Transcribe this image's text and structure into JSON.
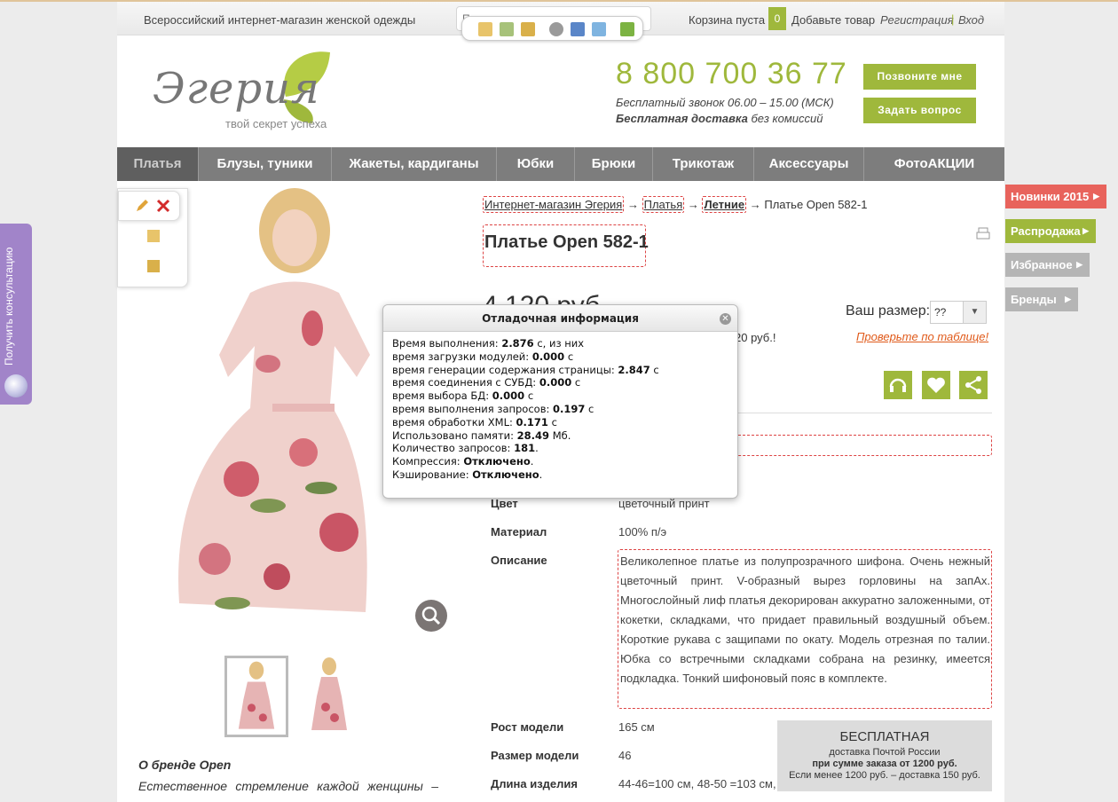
{
  "header": {
    "tagline": "Всероссийский интернет-магазин женской одежды",
    "search_placeholder": "Поиск по всем товарам",
    "cart_text": "Корзина пуста",
    "cart_count": "0",
    "add_item": "Добавьте товар",
    "register": "Регистрация",
    "separator": "|",
    "login": "Вход",
    "logo_name": "Эгерия",
    "logo_slogan": "твой секрет успеха",
    "phone": "8 800 700 36 77",
    "phone_note": "Бесплатный звонок 06.00 – 15.00 (МСК)",
    "delivery_bold": "Бесплатная доставка",
    "delivery_rest": " без комиссий",
    "call_me": "Позвоните мне",
    "ask_question": "Задать вопрос"
  },
  "nav": [
    {
      "label": "Платья"
    },
    {
      "label": "Блузы, туники"
    },
    {
      "label": "Жакеты, кардиганы"
    },
    {
      "label": "Юбки"
    },
    {
      "label": "Брюки"
    },
    {
      "label": "Трикотаж"
    },
    {
      "label": "Аксессуары"
    },
    {
      "label": "ФотоАКЦИИ"
    }
  ],
  "breadcrumb": {
    "home": "Интернет-магазин Эгерия",
    "arrow": "→",
    "cat": "Платья",
    "sub": "Летние",
    "current": "→ Платье Open 582-1"
  },
  "product": {
    "title": "Платье Open 582-1",
    "price": "4 120 руб",
    "size_label": "Ваш размер:",
    "size_value": "??",
    "check_table": "Проверьте по таблице!",
    "partial_price": "20 руб.!",
    "props": {
      "color_label": "Цвет",
      "color_value": "цветочный принт",
      "material_label": "Материал",
      "material_value": "100% п/э",
      "desc_label": "Описание",
      "desc_value": "Великолепное платье из полупрозрачного шифона. Очень нежный цветочный принт. V-образный вырез горловины на запАх. Многослойный лиф платья декорирован аккуратно заложенными, от кокетки, складками, что придает правильный воздушный объем. Короткие рукава с защипами по окату. Модель отрезная по талии. Юбка со встречными складками собрана на резинку, имеется подкладка. Тонкий шифоновый пояс в комплекте.",
      "height_label": "Рост модели",
      "height_value": "165 см",
      "model_size_label": "Размер модели",
      "model_size_value": "46",
      "length_label": "Длина изделия",
      "length_value": "44-46=100 см, 48-50 =103 см,"
    },
    "brand_title": "О бренде Open",
    "brand_text": "Естественное стремление каждой женщины –"
  },
  "free_delivery": {
    "t1": "БЕСПЛАТНАЯ",
    "t2": "доставка Почтой России",
    "t3": "при сумме заказа от 1200 руб.",
    "t4": "Если менее 1200 руб. – доставка 150 руб."
  },
  "debug": {
    "title": "Отладочная информация",
    "close": "✕",
    "lines": [
      {
        "label": "Время выполнения: ",
        "value": "2.876",
        "suffix": " с, из них"
      },
      {
        "label": "время загрузки модулей: ",
        "value": "0.000",
        "suffix": " с"
      },
      {
        "label": "время генерации содержания страницы: ",
        "value": "2.847",
        "suffix": " с"
      },
      {
        "label": "время соединения с СУБД: ",
        "value": "0.000",
        "suffix": " с"
      },
      {
        "label": "время выбора БД: ",
        "value": "0.000",
        "suffix": " с"
      },
      {
        "label": "время выполнения запросов: ",
        "value": "0.197",
        "suffix": " с"
      },
      {
        "label": "время обработки XML: ",
        "value": "0.171",
        "suffix": " с"
      },
      {
        "label": "Использовано памяти: ",
        "value": "28.49",
        "suffix": " Мб."
      },
      {
        "label": "Количество запросов: ",
        "value": "181",
        "suffix": "."
      },
      {
        "label": "Компрессия: ",
        "value": "Отключено",
        "suffix": "."
      },
      {
        "label": "Кэширование: ",
        "value": "Отключено",
        "suffix": "."
      }
    ]
  },
  "side_tabs": [
    {
      "label": "Новинки 2015",
      "color": "#e8635c"
    },
    {
      "label": "Распродажа",
      "color": "#9fb83c"
    },
    {
      "label": "Избранное",
      "color": "#b5b5b5"
    },
    {
      "label": "Бренды",
      "color": "#b5b5b5"
    }
  ],
  "consult": "Получить консультацию",
  "colors": {
    "accent": "#9fb83c",
    "nav": "#7d7d7d",
    "debug_dash": "#dd4444"
  }
}
